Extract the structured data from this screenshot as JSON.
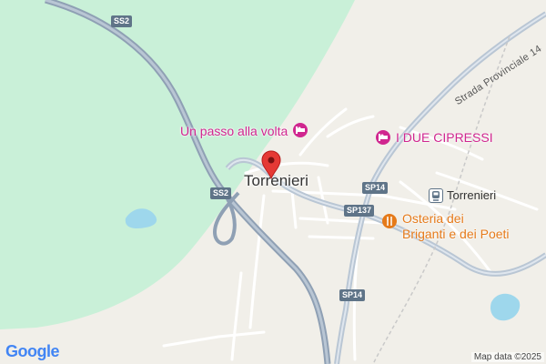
{
  "map": {
    "colors": {
      "land": "#f1efe9",
      "park": "#c9f0d8",
      "water": "#9ed7ec",
      "highway": "#8fa0b4",
      "road": "#ffffff",
      "hotel": "#d0268f",
      "restaurant": "#e57a1a",
      "pin": "#e53935"
    },
    "place": {
      "name": "Torrenieri",
      "icon": "map-pin-icon"
    },
    "roads": {
      "ss2_top": "SS2",
      "ss2_left": "SS2",
      "sp14_top": "SP14",
      "sp137": "SP137",
      "sp14_bottom": "SP14",
      "provinciale": "Strada Provinciale 14"
    },
    "pois": {
      "hotel1": {
        "name": "Un passo alla volta",
        "icon": "hotel-icon"
      },
      "hotel2": {
        "name": "I DUE CIPRESSI",
        "icon": "hotel-icon"
      },
      "station": {
        "name": "Torrenieri",
        "icon": "train-station-icon"
      },
      "restaurant": {
        "line1": "Osteria dei",
        "line2": "Briganti e dei Poeti",
        "icon": "restaurant-icon"
      }
    },
    "logo": "Google",
    "attribution": "Map data ©2025"
  }
}
